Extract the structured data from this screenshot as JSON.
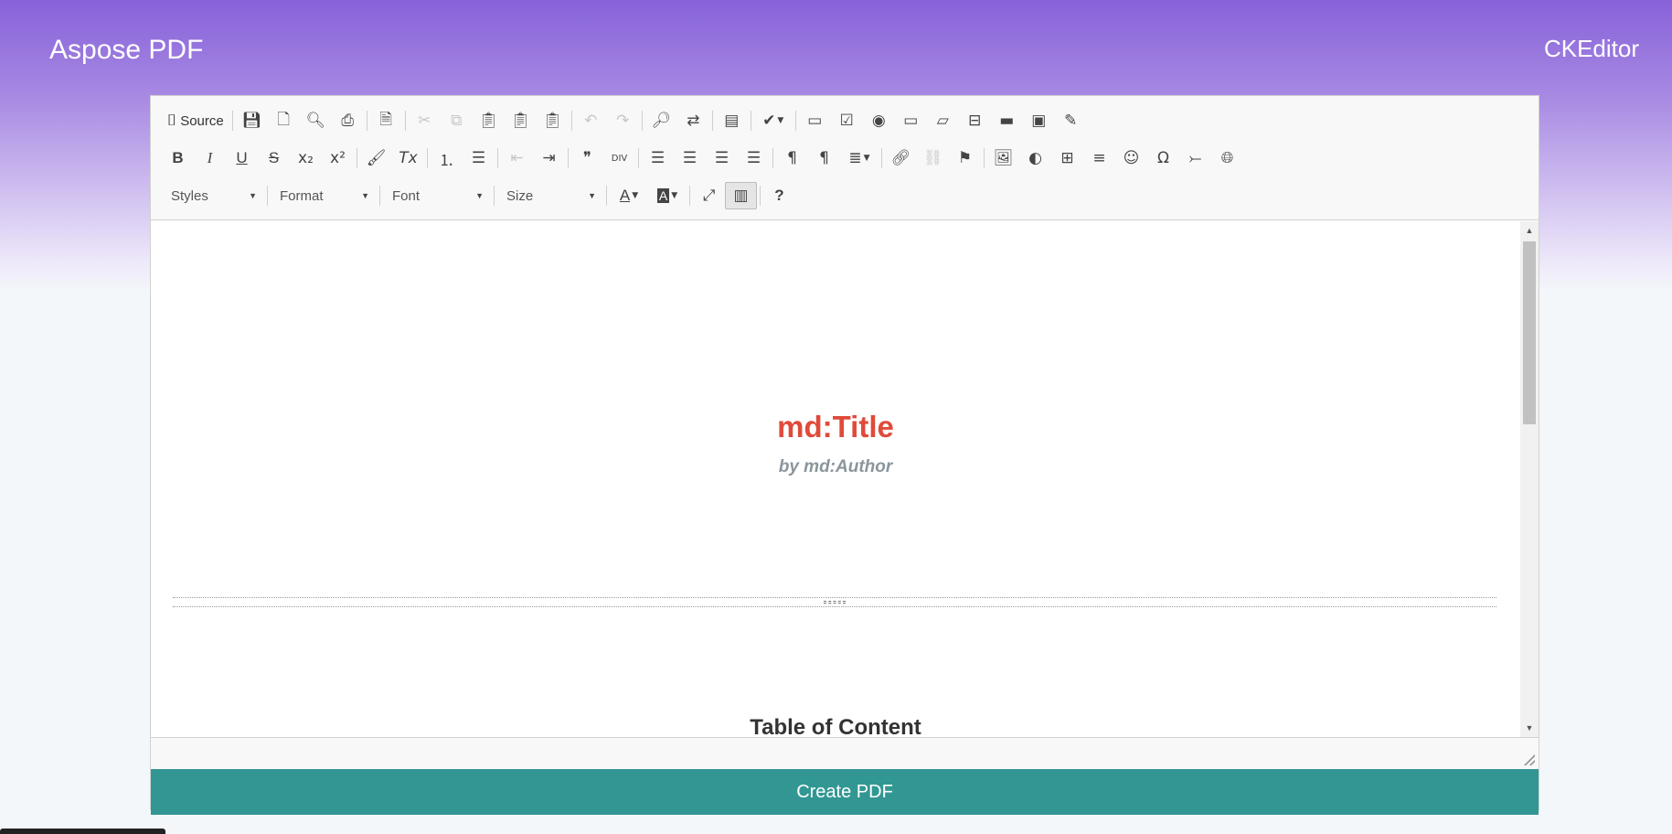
{
  "header": {
    "brand": "Aspose PDF",
    "right_label": "CKEditor"
  },
  "toolbar": {
    "source_label": "Source",
    "styles_label": "Styles",
    "format_label": "Format",
    "font_label": "Font",
    "size_label": "Size",
    "help_label": "?"
  },
  "document": {
    "title": "md:Title",
    "author": "by md:Author",
    "toc_heading": "Table of Content"
  },
  "actions": {
    "create_pdf": "Create PDF"
  },
  "colors": {
    "header_gradient_top": "#8762d9",
    "title_red": "#e04a3a",
    "author_gray": "#8a959b",
    "button_teal": "#329793"
  }
}
